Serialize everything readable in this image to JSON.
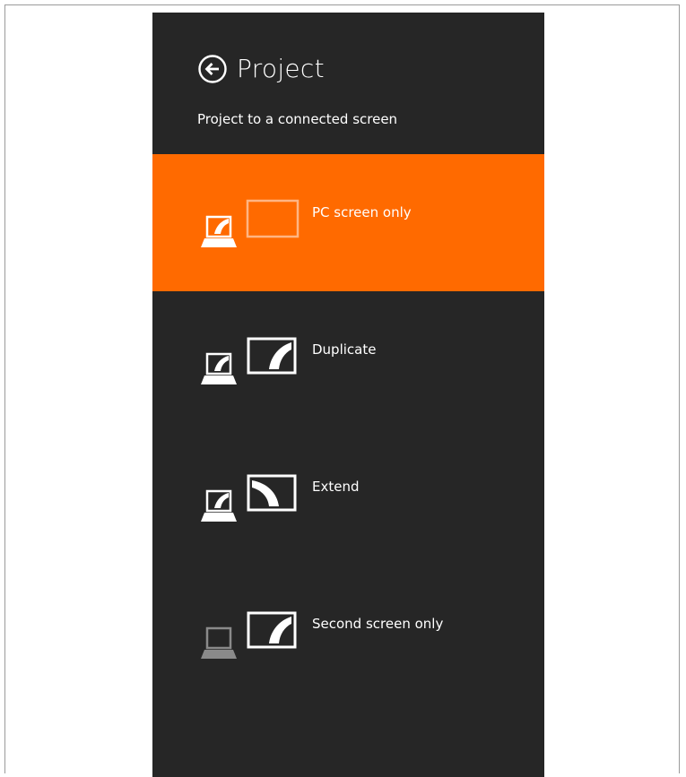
{
  "header": {
    "title": "Project",
    "subtitle": "Project to a connected screen",
    "back_icon": "back-arrow-circle-icon"
  },
  "colors": {
    "pane_background": "#262626",
    "selected_background": "#ff6a00",
    "text": "#ffffff",
    "dimmed_icon": "#8a8a8a"
  },
  "options": [
    {
      "label": "PC screen only",
      "icon": "pc-screen-only-icon",
      "selected": true
    },
    {
      "label": "Duplicate",
      "icon": "duplicate-icon",
      "selected": false
    },
    {
      "label": "Extend",
      "icon": "extend-icon",
      "selected": false
    },
    {
      "label": "Second screen only",
      "icon": "second-screen-only-icon",
      "selected": false
    }
  ]
}
